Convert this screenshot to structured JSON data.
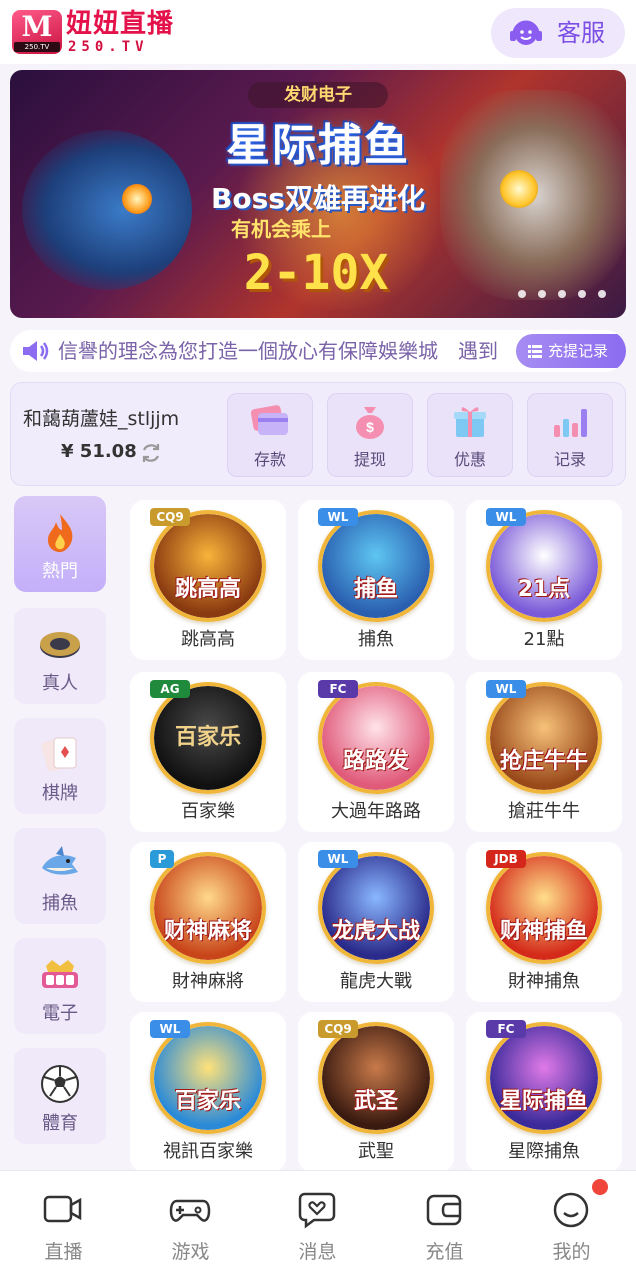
{
  "header": {
    "logo_name": "妞妞直播",
    "logo_domain": "250.TV",
    "logo_badge": "250.TV",
    "service_label": "客服",
    "icons": {
      "service": "headset-smiley-icon"
    }
  },
  "banner": {
    "brand": "发财电子",
    "title": "星际捕鱼",
    "line1": "Boss双雄再进化",
    "line2": "有机会乘上",
    "line3": "2-10X",
    "slide_count": 5,
    "active_slide": 0
  },
  "marquee": {
    "text": "信譽的理念為您打造一個放心有保障娛樂城　遇到",
    "record_label": "充提记录",
    "icons": {
      "speaker": "speaker-icon",
      "record": "list-icon"
    }
  },
  "user": {
    "name": "和藹葫蘆娃_stljjm",
    "balance": "¥ 51.08"
  },
  "actions": [
    {
      "label": "存款",
      "icon": "bank-card-icon"
    },
    {
      "label": "提现",
      "icon": "money-bag-icon"
    },
    {
      "label": "优惠",
      "icon": "gift-icon"
    },
    {
      "label": "记录",
      "icon": "bar-chart-icon"
    }
  ],
  "categories": [
    {
      "label": "熱門",
      "icon": "flame-icon",
      "active": true
    },
    {
      "label": "真人",
      "icon": "poker-chip-icon",
      "active": false
    },
    {
      "label": "棋牌",
      "icon": "playing-cards-icon",
      "active": false
    },
    {
      "label": "捕魚",
      "icon": "shark-icon",
      "active": false
    },
    {
      "label": "電子",
      "icon": "slot-crown-icon",
      "active": false
    },
    {
      "label": "體育",
      "icon": "soccer-ball-icon",
      "active": false
    }
  ],
  "games": [
    {
      "name": "跳高高",
      "provider": "CQ9",
      "art": "跳高高"
    },
    {
      "name": "捕魚",
      "provider": "WL",
      "art": "捕鱼"
    },
    {
      "name": "21點",
      "provider": "WL",
      "art": "21点"
    },
    {
      "name": "百家樂",
      "provider": "AG",
      "art": "百家乐"
    },
    {
      "name": "大過年路路",
      "provider": "FC",
      "art": "路路发"
    },
    {
      "name": "搶莊牛牛",
      "provider": "WL",
      "art": "抢庄牛牛"
    },
    {
      "name": "財神麻將",
      "provider": "P",
      "art": "财神麻将"
    },
    {
      "name": "龍虎大戰",
      "provider": "WL",
      "art": "龙虎大战"
    },
    {
      "name": "財神捕魚",
      "provider": "JDB",
      "art": "财神捕鱼"
    },
    {
      "name": "視訊百家樂",
      "provider": "WL",
      "art": "百家乐"
    },
    {
      "name": "武聖",
      "provider": "CQ9",
      "art": "武圣"
    },
    {
      "name": "星際捕魚",
      "provider": "FC",
      "art": "星际捕鱼"
    }
  ],
  "bottom_nav": [
    {
      "label": "直播",
      "icon": "video-camera-icon"
    },
    {
      "label": "游戏",
      "icon": "gamepad-icon"
    },
    {
      "label": "消息",
      "icon": "chat-heart-icon"
    },
    {
      "label": "充值",
      "icon": "wallet-icon"
    },
    {
      "label": "我的",
      "icon": "smiley-profile-icon",
      "has_notification": true
    }
  ],
  "colors": {
    "accent": "#7b4ee6",
    "brand_red": "#e4124a",
    "active_category": "#c4affa",
    "notification": "#f0453a"
  }
}
